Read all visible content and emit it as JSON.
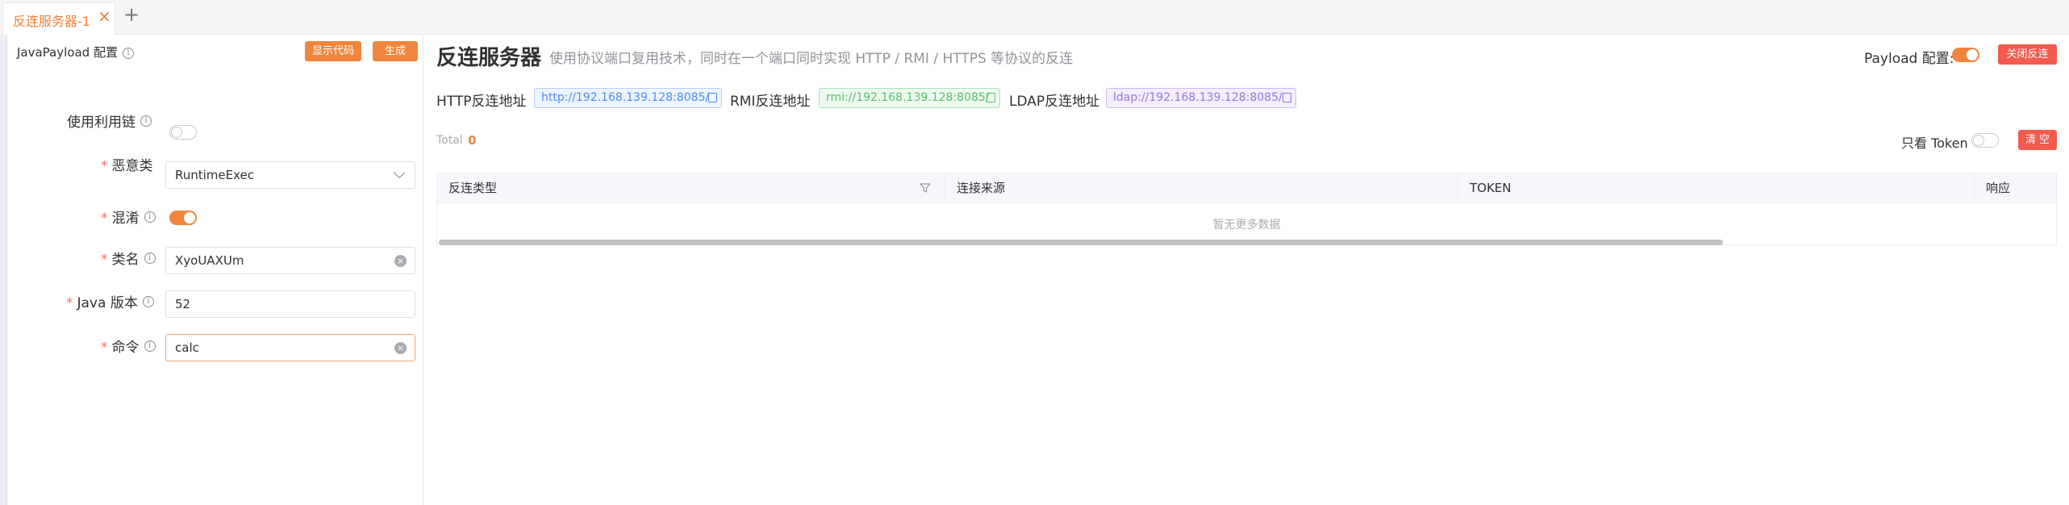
{
  "tabs": {
    "active_label": "反连服务器-1",
    "close_glyph": "×",
    "add_glyph": "+"
  },
  "left_panel": {
    "title": "JavaPayload 配置",
    "show_code_label": "显示代码",
    "generate_label": "生成",
    "use_chain": {
      "label": "使用利用链",
      "enabled": false
    },
    "malicious_class": {
      "label": "恶意类",
      "value": "RuntimeExec",
      "required": true
    },
    "obfuscate": {
      "label": "混淆",
      "enabled": true,
      "required": true
    },
    "class_name": {
      "label": "类名",
      "value": "XyoUAXUm",
      "required": true
    },
    "java_version": {
      "label": "Java 版本",
      "value": "52",
      "required": true
    },
    "command": {
      "label": "命令",
      "value": "calc",
      "required": true
    }
  },
  "right_panel": {
    "title": "反连服务器",
    "description": "使用协议端口复用技术，同时在一个端口同时实现 HTTP / RMI / HTTPS 等协议的反连",
    "payload_config_label": "Payload 配置:",
    "payload_config_enabled": true,
    "close_reverse_label": "关闭反连",
    "http": {
      "label": "HTTP反连地址",
      "url": "http://192.168.139.128:8085/"
    },
    "rmi": {
      "label": "RMI反连地址",
      "url": "rmi://192.168.139.128:8085/"
    },
    "ldap": {
      "label": "LDAP反连地址",
      "url": "ldap://192.168.139.128:8085/"
    },
    "total_label": "Total",
    "total_value": "0",
    "token_only_label": "只看 Token",
    "token_only_enabled": false,
    "clear_label": "清 空",
    "table": {
      "columns": [
        "反连类型",
        "连接来源",
        "TOKEN",
        "响应"
      ],
      "empty_text": "暂无更多数据"
    }
  },
  "colors": {
    "accent": "#f0863e",
    "danger": "#f25b4e",
    "http": "#4a8cf0",
    "rmi": "#56c16e",
    "ldap": "#9a74e0"
  }
}
